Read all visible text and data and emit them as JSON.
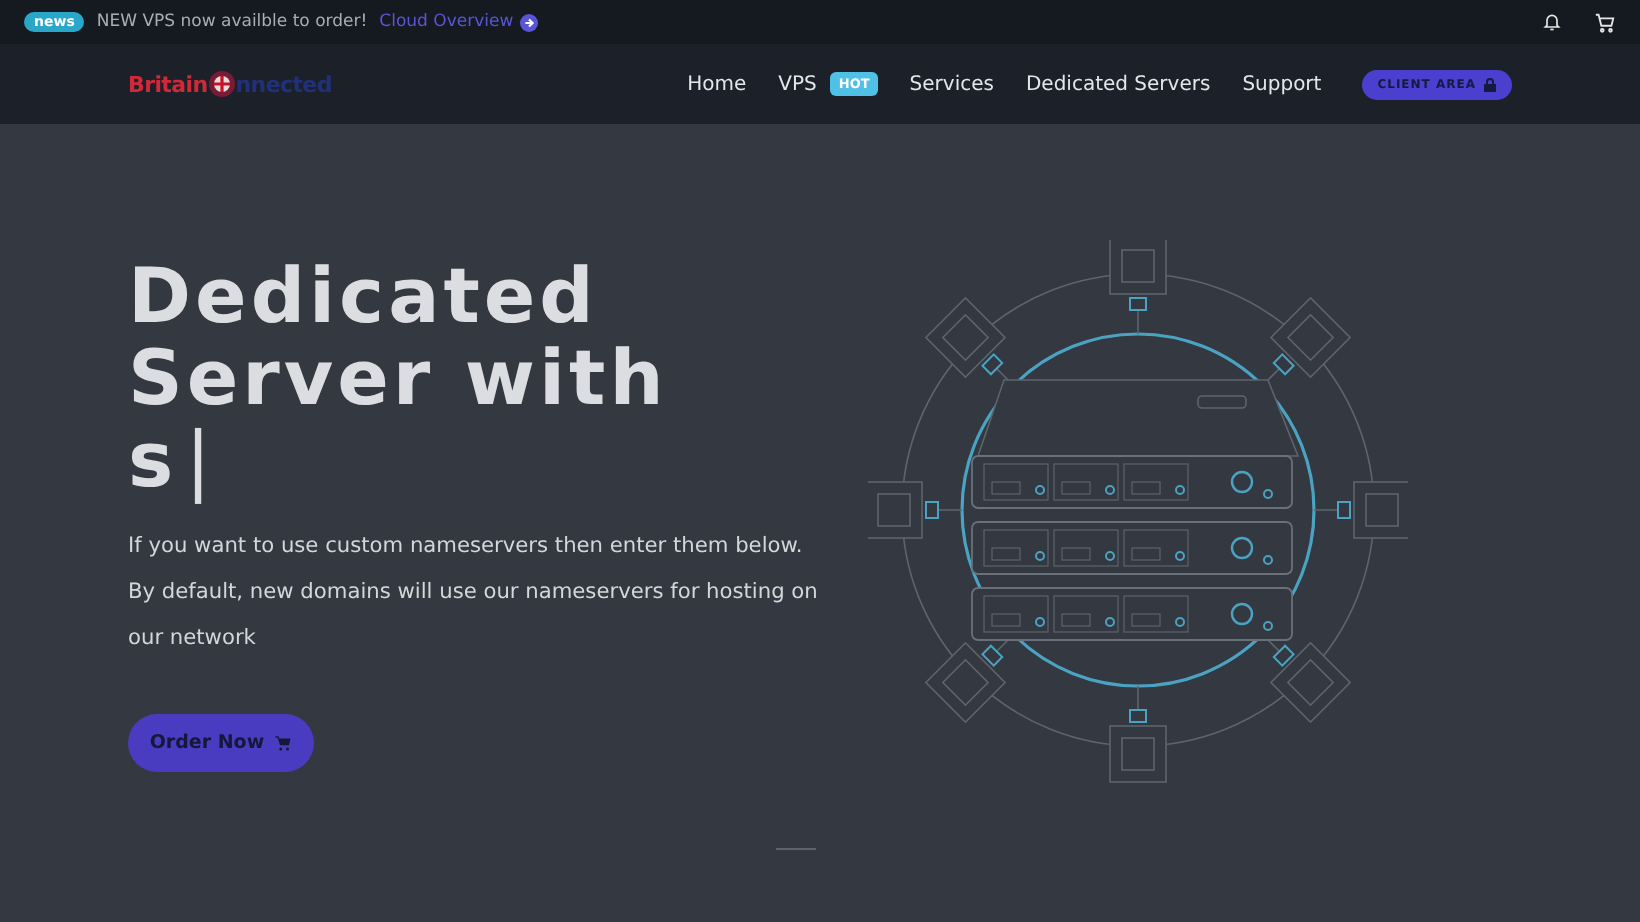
{
  "announcement": {
    "badge": "news",
    "text": "NEW VPS now availble to order!",
    "link": "Cloud Overview"
  },
  "logo": {
    "first": "Britain",
    "second": "nnected"
  },
  "nav": [
    {
      "label": "Home"
    },
    {
      "label": "VPS",
      "badge": "HOT"
    },
    {
      "label": "Services"
    },
    {
      "label": "Dedicated Servers"
    },
    {
      "label": "Support"
    }
  ],
  "client_area": {
    "label": "CLIENT AREA"
  },
  "hero": {
    "heading_lines": [
      "Dedicated",
      "Server with",
      "s"
    ],
    "cursor": "|",
    "text": "If you want to use custom nameservers then enter them below. By default, new domains will use our nameservers for hosting on our network",
    "button": "Order Now"
  }
}
